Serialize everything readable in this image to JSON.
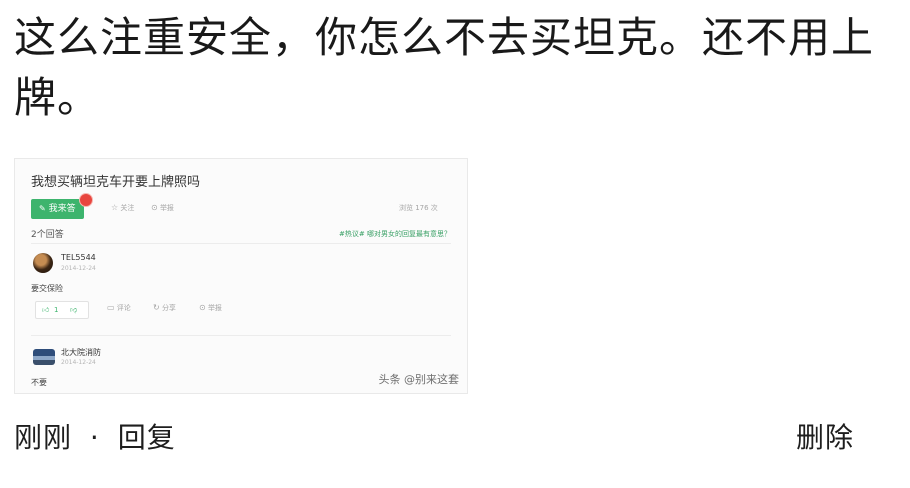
{
  "comment": {
    "text": "这么注重安全，你怎么不去买坦克。还不用上牌。",
    "time": "刚刚",
    "separator": "·",
    "reply_label": "回复",
    "delete_label": "删除"
  },
  "embedded_screenshot": {
    "question_title": "我想买辆坦克车开要上牌照吗",
    "answer_button": "我来答",
    "follow_label": "关注",
    "report_label": "举报",
    "views_label": "浏览 176 次",
    "answer_count": "2个回答",
    "hint_text": "#热议# 哪对男女的回复最有意思？",
    "answers": [
      {
        "user": "TEL5544",
        "date": "2014-12-24",
        "text": "要交保险",
        "upvotes": "1",
        "comment_label": "评论",
        "share_label": "分享",
        "report_label": "举报"
      },
      {
        "user": "北大院消防",
        "date": "2014-12-24",
        "text": "不要"
      }
    ],
    "watermark": "头条 @别来这套"
  },
  "colors": {
    "accent_green": "#3db46d",
    "badge_red": "#e8463f"
  },
  "icons": {
    "thumb_up": "thumb-up-icon",
    "thumb_down": "thumb-down-icon",
    "comment": "comment-icon",
    "share": "share-icon",
    "report": "report-icon",
    "edit": "edit-icon"
  }
}
